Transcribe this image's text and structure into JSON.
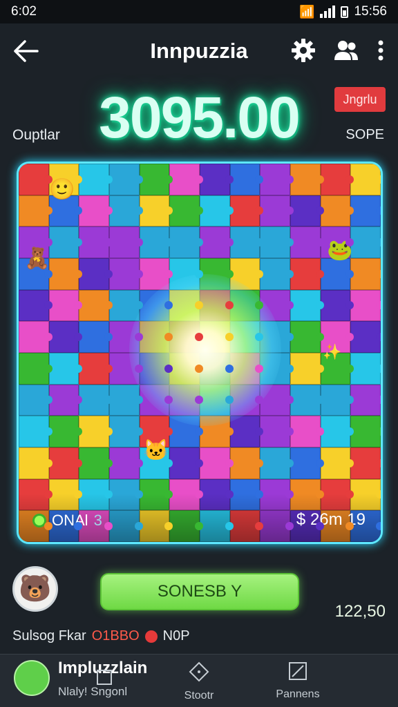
{
  "status_bar": {
    "time": "6:02",
    "right_time": "15:56"
  },
  "app_bar": {
    "title": "Innpuzzia",
    "icons": [
      "back-arrow-icon",
      "gear-icon",
      "people-icon",
      "more-vert-icon"
    ]
  },
  "score": {
    "value": "3095.00",
    "badge": "Jngrlu",
    "left_label": "Ouptlar",
    "right_label": "SOPE"
  },
  "board": {
    "bottom_left_text": "ONAl",
    "bottom_left_suffix": "3",
    "bottom_right_text": "$ 26m 19",
    "colors": [
      "#e63d3d",
      "#2f6fe0",
      "#38b832",
      "#f7d02a",
      "#9b3ad6",
      "#e84fc8",
      "#27c6e8",
      "#f08a24",
      "#5b2fc4",
      "#2aa7d8"
    ]
  },
  "bottom": {
    "cta_label": "SONESB Y",
    "side_value": "122,50",
    "footer_left": "Sulsog Fkar",
    "footer_accent": "O1BBO",
    "footer_right": "N0P"
  },
  "nav": {
    "user_name": "Impluzzlain",
    "user_sub": "Nlaly! Sngonl",
    "items": [
      {
        "label": "",
        "icon": "square-icon"
      },
      {
        "label": "Stootr",
        "icon": "diamond-icon"
      },
      {
        "label": "Pannens",
        "icon": "edit-square-icon"
      }
    ]
  }
}
